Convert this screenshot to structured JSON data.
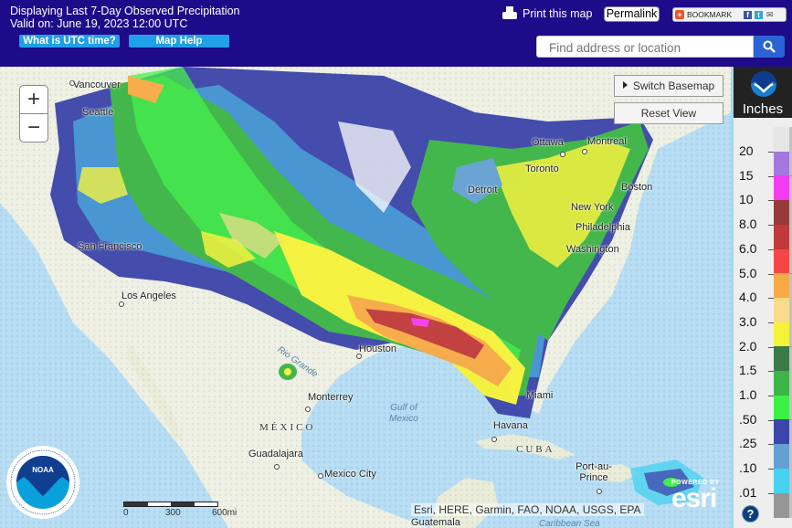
{
  "header": {
    "title": "Displaying Last 7-Day Observed Precipitation",
    "valid": "Valid on: June 19, 2023 12:00 UTC",
    "utc_button": "What is UTC time?",
    "help_button": "Map Help",
    "print_label": "Print this map",
    "permalink_label": "Permalink",
    "bookmark_label": "BOOKMARK",
    "search": {
      "placeholder": "Find address or location",
      "value": ""
    }
  },
  "map": {
    "zoom_in": "+",
    "zoom_out": "−",
    "switch_basemap": "Switch Basemap",
    "reset_view": "Reset View",
    "scalebar": {
      "labels": [
        "0",
        "300",
        "600mi"
      ]
    },
    "attribution": "Esri, HERE, Garmin, FAO, NOAA, USGS, EPA",
    "esri_powered": "POWERED BY",
    "esri_word": "esri",
    "places": [
      {
        "name": "Vancouver",
        "type": "city"
      },
      {
        "name": "Seattle",
        "type": "city"
      },
      {
        "name": "San Francisco",
        "type": "city"
      },
      {
        "name": "Los Angeles",
        "type": "city"
      },
      {
        "name": "Ottawa",
        "type": "city"
      },
      {
        "name": "Montreal",
        "type": "city"
      },
      {
        "name": "Toronto",
        "type": "city"
      },
      {
        "name": "Detroit",
        "type": "city"
      },
      {
        "name": "Boston",
        "type": "city"
      },
      {
        "name": "New York",
        "type": "city"
      },
      {
        "name": "Philadelphia",
        "type": "city"
      },
      {
        "name": "Washington",
        "type": "city"
      },
      {
        "name": "Houston",
        "type": "city"
      },
      {
        "name": "Monterrey",
        "type": "city"
      },
      {
        "name": "Guadalajara",
        "type": "city"
      },
      {
        "name": "Mexico City",
        "type": "city"
      },
      {
        "name": "Miami",
        "type": "city"
      },
      {
        "name": "Havana",
        "type": "city"
      },
      {
        "name": "Port-au-Prince",
        "type": "city"
      },
      {
        "name": "Guatemala",
        "type": "city"
      },
      {
        "name": "MÉXICO",
        "type": "country"
      },
      {
        "name": "CUBA",
        "type": "country"
      },
      {
        "name": "Gulf of Mexico",
        "type": "water"
      },
      {
        "name": "Caribbean Sea",
        "type": "water"
      },
      {
        "name": "Rio Grande",
        "type": "water"
      }
    ]
  },
  "legend": {
    "unit": "Inches",
    "help": "?",
    "classes": [
      {
        "label": "20",
        "color": "#e6e6e6"
      },
      {
        "label": "15",
        "color": "#a578e0"
      },
      {
        "label": "10",
        "color": "#f23cf2"
      },
      {
        "label": "8.0",
        "color": "#963a3a"
      },
      {
        "label": "6.0",
        "color": "#c03a3a"
      },
      {
        "label": "5.0",
        "color": "#f44646"
      },
      {
        "label": "4.0",
        "color": "#f7aa46"
      },
      {
        "label": "3.0",
        "color": "#f8dc8c"
      },
      {
        "label": "2.0",
        "color": "#f5f23a"
      },
      {
        "label": "1.5",
        "color": "#3c7a46"
      },
      {
        "label": "1.0",
        "color": "#3cb446"
      },
      {
        "label": ".50",
        "color": "#3cf046"
      },
      {
        "label": ".25",
        "color": "#3c46aa"
      },
      {
        "label": ".10",
        "color": "#64a0d2"
      },
      {
        "label": ".01",
        "color": "#46d2f0"
      },
      {
        "label": "",
        "color": "#969696"
      }
    ]
  }
}
